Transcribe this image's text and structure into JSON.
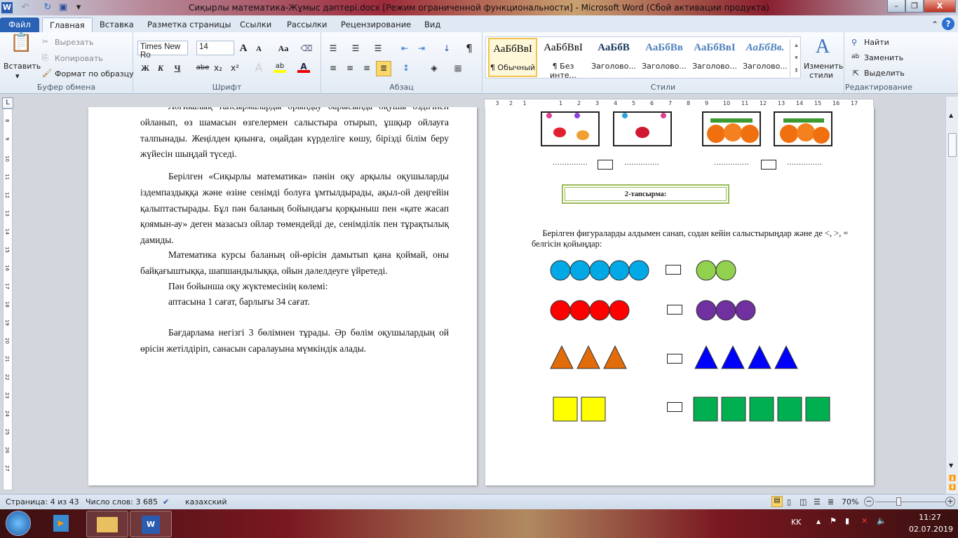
{
  "window": {
    "title": "Сиқырлы математика-Жұмыс дәптері.docx [Режим ограниченной функциональности]  -  Microsoft Word (Сбой активации продукта)"
  },
  "tabs": [
    "Файл",
    "Главная",
    "Вставка",
    "Разметка страницы",
    "Ссылки",
    "Рассылки",
    "Рецензирование",
    "Вид"
  ],
  "clipboard": {
    "paste": "Вставить",
    "cut": "Вырезать",
    "copy": "Копировать",
    "format_painter": "Формат по образцу",
    "label": "Буфер обмена"
  },
  "font": {
    "name": "Times New Ro",
    "size": "14",
    "label": "Шрифт",
    "bold": "Ж",
    "italic": "К",
    "underline": "Ч",
    "strike": "abe",
    "sub": "x₂",
    "sup": "x²",
    "grow": "A",
    "shrink": "A",
    "case": "Aa"
  },
  "paragraph": {
    "label": "Абзац",
    "pilcrow": "¶"
  },
  "styles": {
    "label": "Стили",
    "items": [
      {
        "sample": "АаБбВвІ",
        "name": "¶ Обычный"
      },
      {
        "sample": "АаБбВвІ",
        "name": "¶ Без инте..."
      },
      {
        "sample": "АаБбВ",
        "name": "Заголово..."
      },
      {
        "sample": "АаБбВв",
        "name": "Заголово..."
      },
      {
        "sample": "АаБбВвІ",
        "name": "Заголово..."
      },
      {
        "sample": "АаБбВв.",
        "name": "Заголово..."
      }
    ],
    "change": "Изменить стили"
  },
  "editing": {
    "label": "Редактирование",
    "find": "Найти",
    "replace": "Заменить",
    "select": "Выделить"
  },
  "left_page": {
    "paragraphs": [
      "Логикалық тапсырмаларды орындау барысында оқушы өздігінен ойланып, өз шамасын өзгелермен  салыстыра отырып, ұшқыр ойлауға талпынады. Жеңілден қиынға, оңайдан күрделіге көшу, бірізді білім беру жүйесін шыңдай түседі.",
      "Берілген «Сиқырлы математика» пәнін оқу арқылы оқушыларды іздемпаздыққа және өзіне сенімді болуға ұмтылдырады, ақыл-ой деңгейін қалыптастырады. Бұл пән баланың бойындағы қорқыныш пен «қате жасап қоямын-ау» деген мазасыз ойлар төмендейді де, сенімділік пен тұрақтылық дамиды.",
      "Математика курсы баланың ой-өрісін дамытып қана қоймай, оны байқағыштыққа, шапшандылыққа, ойын дәлелдеуге үйретеді.",
      "Пән бойынша оқу жүктемесінің көлемі:",
      "аптасына 1 сағат, барлығы  34 сағат.",
      "Бағдарлама негізгі 3 бөлімнен тұрады. Әр бөлім оқушылардың ой өрісін жетілдіріп, санасын саралауына мүмкіндік алады."
    ]
  },
  "right_page": {
    "dots": "……………",
    "task_title": "2-тапсырма:",
    "instruction": "Берілген фигураларды алдымен санап, содан кейін салыстырыңдар және де <, >, = белгісін қойыңдар:",
    "rows": [
      {
        "shape": "circle",
        "left": {
          "count": 5,
          "color": "#00a9e6"
        },
        "right": {
          "count": 2,
          "color": "#92d050"
        }
      },
      {
        "shape": "circle",
        "left": {
          "count": 4,
          "color": "#ff0000"
        },
        "right": {
          "count": 3,
          "color": "#7030a0"
        }
      },
      {
        "shape": "triangle",
        "left": {
          "count": 3,
          "color": "#e36c0a"
        },
        "right": {
          "count": 4,
          "color": "#0000ff"
        }
      },
      {
        "shape": "square",
        "left": {
          "count": 2,
          "color": "#ffff00"
        },
        "right": {
          "count": 5,
          "color": "#00b050"
        }
      }
    ]
  },
  "status": {
    "page": "Страница: 4 из 43",
    "words": "Число слов: 3 685",
    "language": "казахский",
    "zoom": "70%"
  },
  "taskbar": {
    "lang": "KK",
    "time": "11:27",
    "date": "02.07.2019"
  }
}
